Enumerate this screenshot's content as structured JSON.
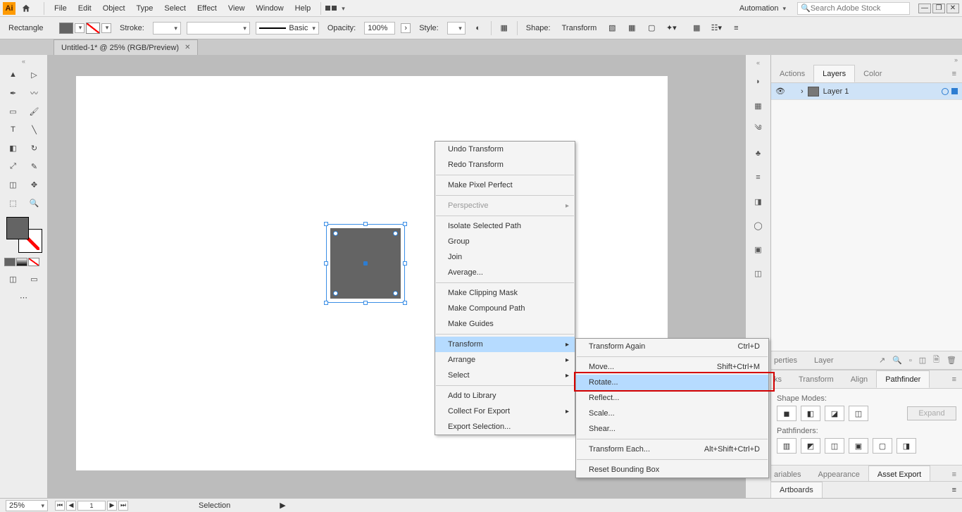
{
  "app": {
    "logo": "Ai"
  },
  "menubar": [
    "File",
    "Edit",
    "Object",
    "Type",
    "Select",
    "Effect",
    "View",
    "Window",
    "Help"
  ],
  "automation_label": "Automation",
  "search_placeholder": "Search Adobe Stock",
  "controlbar": {
    "shape_label": "Rectangle",
    "stroke_label": "Stroke:",
    "line_style": "Basic",
    "opacity_label": "Opacity:",
    "opacity_value": "100%",
    "style_label": "Style:",
    "shape_btn": "Shape:",
    "transform_btn": "Transform"
  },
  "doc_tab": "Untitled-1* @ 25% (RGB/Preview)",
  "context_menu": [
    {
      "label": "Undo Transform"
    },
    {
      "label": "Redo Transform"
    },
    {
      "sep": true
    },
    {
      "label": "Make Pixel Perfect"
    },
    {
      "sep": true
    },
    {
      "label": "Perspective",
      "arrow": true,
      "disabled": true
    },
    {
      "sep": true
    },
    {
      "label": "Isolate Selected Path"
    },
    {
      "label": "Group"
    },
    {
      "label": "Join"
    },
    {
      "label": "Average..."
    },
    {
      "sep": true
    },
    {
      "label": "Make Clipping Mask"
    },
    {
      "label": "Make Compound Path"
    },
    {
      "label": "Make Guides"
    },
    {
      "sep": true
    },
    {
      "label": "Transform",
      "arrow": true,
      "hov": true
    },
    {
      "label": "Arrange",
      "arrow": true
    },
    {
      "label": "Select",
      "arrow": true
    },
    {
      "sep": true
    },
    {
      "label": "Add to Library"
    },
    {
      "label": "Collect For Export",
      "arrow": true
    },
    {
      "label": "Export Selection..."
    }
  ],
  "submenu": [
    {
      "label": "Transform Again",
      "shortcut": "Ctrl+D"
    },
    {
      "sep": true
    },
    {
      "label": "Move...",
      "shortcut": "Shift+Ctrl+M"
    },
    {
      "label": "Rotate...",
      "hov": true
    },
    {
      "label": "Reflect..."
    },
    {
      "label": "Scale..."
    },
    {
      "label": "Shear..."
    },
    {
      "sep": true
    },
    {
      "label": "Transform Each...",
      "shortcut": "Alt+Shift+Ctrl+D"
    },
    {
      "sep": true
    },
    {
      "label": "Reset Bounding Box"
    }
  ],
  "panels": {
    "tabs1": [
      "Actions",
      "Layers",
      "Color"
    ],
    "active1": "Layers",
    "layer_name": "Layer 1",
    "tabs2_visible": [
      "ks",
      "Transform",
      "Align",
      "Pathfinder"
    ],
    "active2": "Pathfinder",
    "shape_modes_label": "Shape Modes:",
    "pathfinders_label": "Pathfinders:",
    "expand_label": "Expand",
    "tabs3_visible": [
      "ariables",
      "Appearance",
      "Asset Export"
    ],
    "active3": "Asset Export",
    "properties_label": "perties",
    "layer_label": "Layer",
    "artboards_label": "Artboards"
  },
  "statusbar": {
    "zoom": "25%",
    "artboard_nav": "1",
    "mode": "Selection"
  }
}
